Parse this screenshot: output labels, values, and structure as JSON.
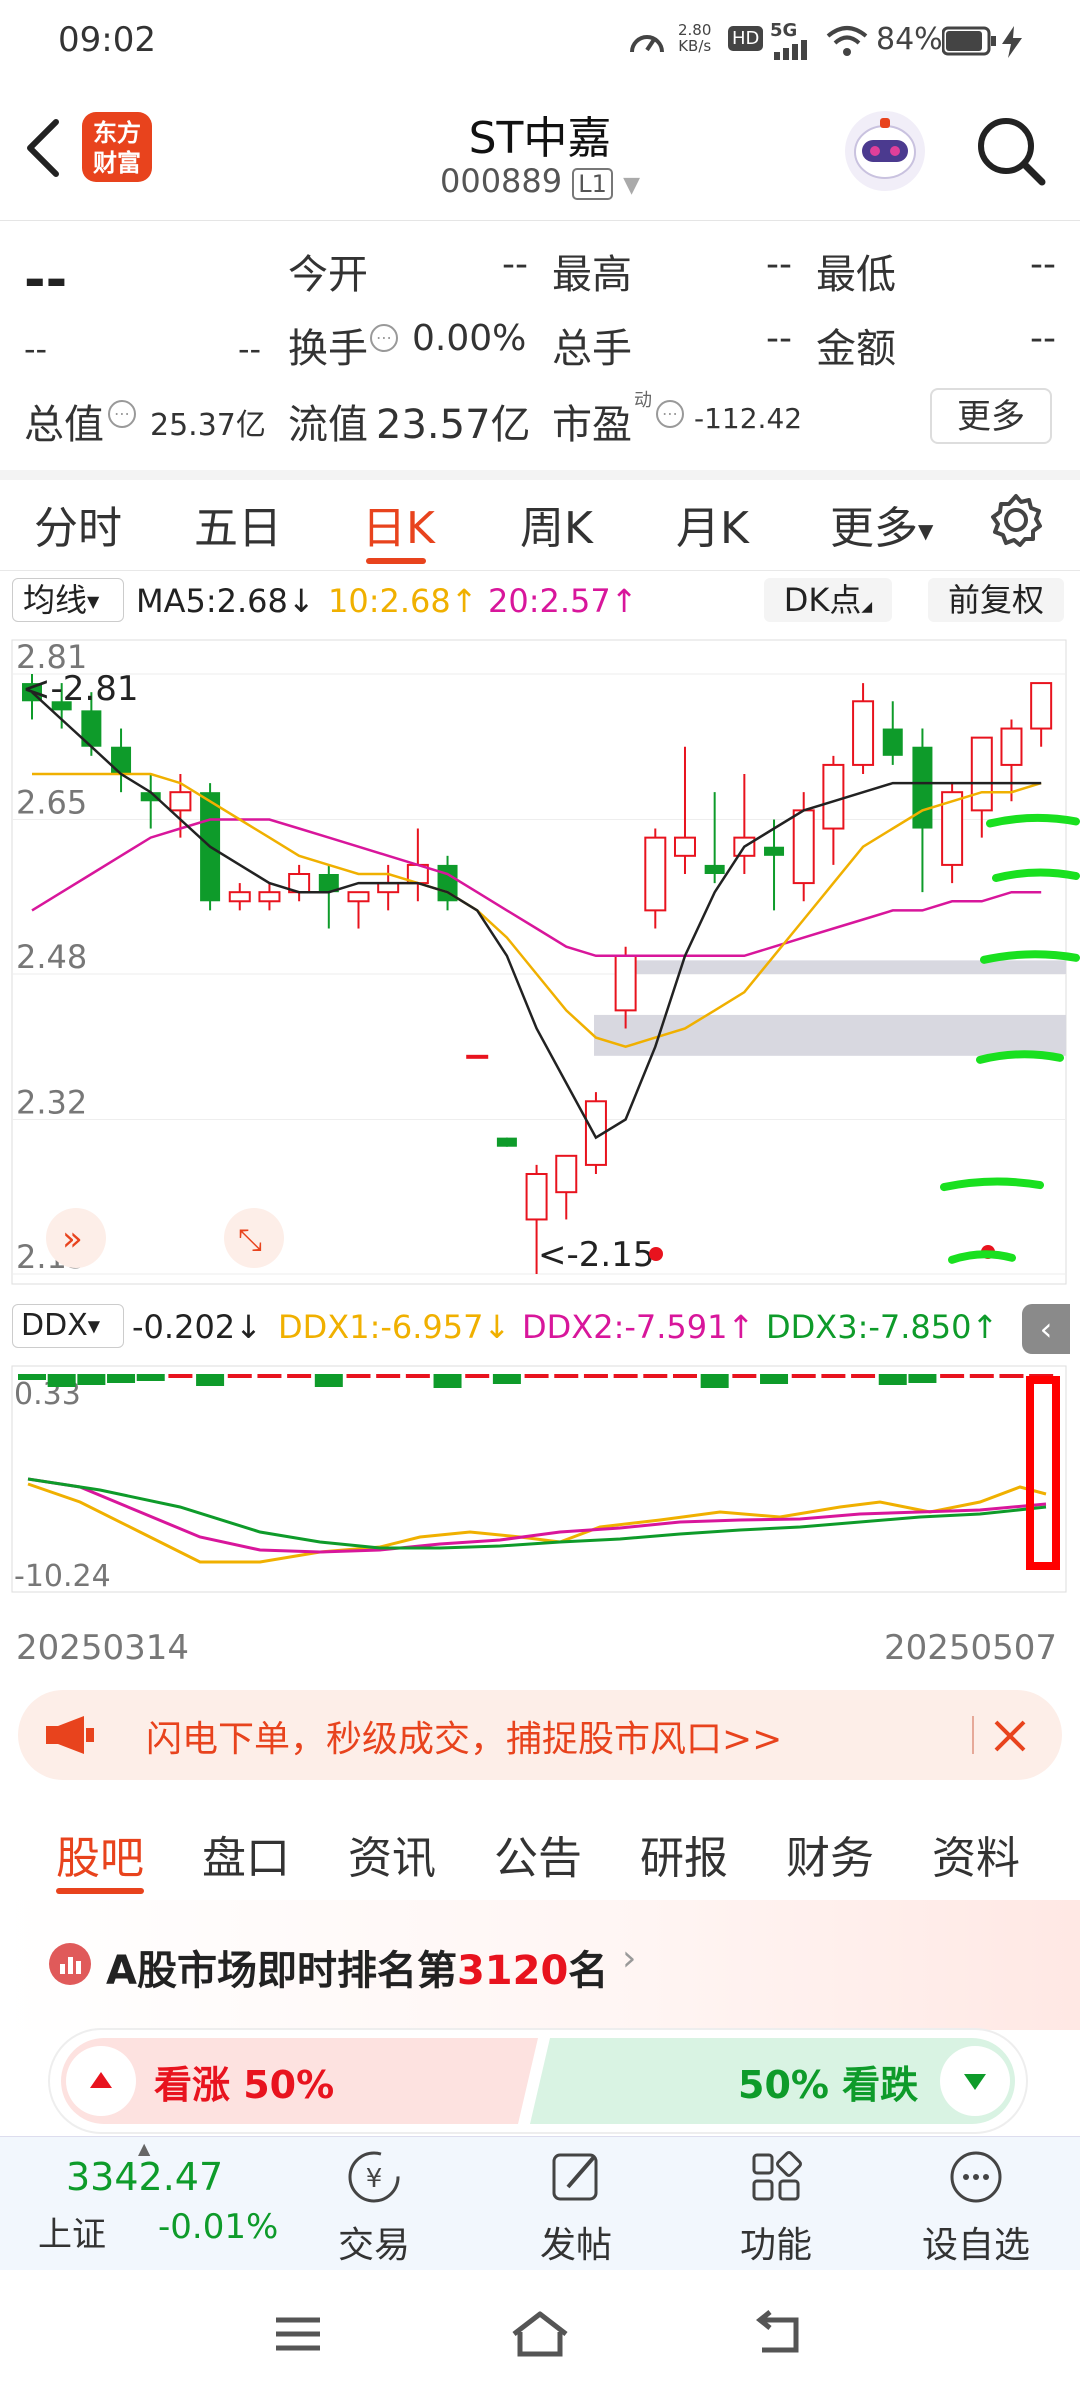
{
  "status": {
    "time": "09:02",
    "speed_value": "2.80",
    "speed_unit": "KB/s",
    "hd": "HD",
    "net": "5G",
    "battery": "84%"
  },
  "header": {
    "title": "ST中嘉",
    "code": "000889",
    "level": "L1",
    "logo_line1": "东方",
    "logo_line2": "财富"
  },
  "quote": {
    "price": "--",
    "change": "--",
    "change_pct": "--",
    "open_label": "今开",
    "open": "--",
    "high_label": "最高",
    "high": "--",
    "low_label": "最低",
    "low": "--",
    "turnover_label": "换手",
    "turnover": "0.00%",
    "volume_label": "总手",
    "volume": "--",
    "amount_label": "金额",
    "amount": "--",
    "mktcap_label": "总值",
    "mktcap": "25.37亿",
    "float_label": "流值",
    "float": "23.57亿",
    "pe_label": "市盈",
    "pe_sup": "动",
    "pe": "-112.42",
    "more_button": "更多"
  },
  "period_tabs": [
    "分时",
    "五日",
    "日K",
    "周K",
    "月K",
    "更多"
  ],
  "active_period": "日K",
  "ma_bar": {
    "selector": "均线",
    "ma5": "MA5:2.68",
    "ma10": "10:2.68",
    "ma20": "20:2.57",
    "dk": "DK点",
    "adjust": "前复权"
  },
  "ddx_bar": {
    "selector": "DDX",
    "ddx": "-0.202",
    "ddx1": "DDX1:-6.957",
    "ddx2": "DDX2:-7.591",
    "ddx3": "DDX3:-7.850"
  },
  "colors": {
    "up": "#e8131e",
    "down": "#0e9b2a",
    "ma5": "#222222",
    "ma10": "#f0b000",
    "ma20": "#d8169b",
    "accent": "#e8431d"
  },
  "chart_data": {
    "type": "candlestick",
    "y_ticks": [
      "2.81",
      "2.65",
      "2.48",
      "2.32",
      "2.15"
    ],
    "ylim": [
      2.15,
      2.81
    ],
    "max_marker": "<-2.81",
    "min_marker": "<-2.15",
    "start_date": "20250314",
    "end_date": "20250507",
    "ddx_ticks": [
      "0.33",
      "-10.24"
    ],
    "candles": [
      [
        2.8,
        2.81,
        2.76,
        2.78
      ],
      [
        2.78,
        2.8,
        2.75,
        2.77
      ],
      [
        2.77,
        2.79,
        2.72,
        2.73
      ],
      [
        2.73,
        2.75,
        2.68,
        2.7
      ],
      [
        2.68,
        2.7,
        2.64,
        2.67
      ],
      [
        2.66,
        2.7,
        2.63,
        2.68
      ],
      [
        2.68,
        2.69,
        2.55,
        2.56
      ],
      [
        2.56,
        2.58,
        2.55,
        2.57
      ],
      [
        2.56,
        2.58,
        2.55,
        2.57
      ],
      [
        2.57,
        2.6,
        2.56,
        2.59
      ],
      [
        2.59,
        2.6,
        2.53,
        2.57
      ],
      [
        2.56,
        2.57,
        2.53,
        2.57
      ],
      [
        2.57,
        2.6,
        2.55,
        2.58
      ],
      [
        2.58,
        2.64,
        2.56,
        2.6
      ],
      [
        2.6,
        2.61,
        2.55,
        2.56
      ],
      [
        2.39,
        2.39,
        2.39,
        2.39
      ],
      [
        2.3,
        2.3,
        2.29,
        2.29
      ],
      [
        2.21,
        2.27,
        2.15,
        2.26
      ],
      [
        2.24,
        2.28,
        2.21,
        2.28
      ],
      [
        2.27,
        2.35,
        2.26,
        2.34
      ],
      [
        2.44,
        2.51,
        2.42,
        2.5
      ],
      [
        2.55,
        2.64,
        2.53,
        2.63
      ],
      [
        2.61,
        2.73,
        2.59,
        2.63
      ],
      [
        2.6,
        2.68,
        2.58,
        2.59
      ],
      [
        2.61,
        2.7,
        2.59,
        2.63
      ],
      [
        2.62,
        2.65,
        2.55,
        2.61
      ],
      [
        2.58,
        2.68,
        2.56,
        2.66
      ],
      [
        2.64,
        2.72,
        2.6,
        2.71
      ],
      [
        2.71,
        2.8,
        2.7,
        2.78
      ],
      [
        2.75,
        2.78,
        2.71,
        2.72
      ],
      [
        2.73,
        2.75,
        2.57,
        2.64
      ],
      [
        2.6,
        2.69,
        2.58,
        2.68
      ],
      [
        2.66,
        2.74,
        2.63,
        2.74
      ],
      [
        2.71,
        2.76,
        2.67,
        2.75
      ],
      [
        2.75,
        2.8,
        2.73,
        2.8
      ]
    ],
    "ma5": [
      2.79,
      2.76,
      2.73,
      2.7,
      2.68,
      2.65,
      2.62,
      2.6,
      2.58,
      2.57,
      2.57,
      2.58,
      2.58,
      2.58,
      2.57,
      2.55,
      2.5,
      2.42,
      2.36,
      2.3,
      2.32,
      2.4,
      2.5,
      2.57,
      2.62,
      2.64,
      2.66,
      2.67,
      2.68,
      2.69,
      2.69,
      2.69,
      2.69,
      2.69,
      2.69
    ],
    "ma10": [
      2.7,
      2.7,
      2.7,
      2.7,
      2.7,
      2.69,
      2.67,
      2.65,
      2.63,
      2.61,
      2.6,
      2.59,
      2.59,
      2.58,
      2.57,
      2.55,
      2.52,
      2.48,
      2.44,
      2.41,
      2.4,
      2.41,
      2.42,
      2.44,
      2.46,
      2.5,
      2.54,
      2.58,
      2.62,
      2.64,
      2.66,
      2.67,
      2.68,
      2.68,
      2.69
    ],
    "ma20": [
      2.55,
      2.57,
      2.59,
      2.61,
      2.63,
      2.64,
      2.65,
      2.65,
      2.65,
      2.64,
      2.63,
      2.62,
      2.61,
      2.6,
      2.59,
      2.57,
      2.55,
      2.53,
      2.51,
      2.5,
      2.5,
      2.5,
      2.5,
      2.5,
      2.5,
      2.51,
      2.52,
      2.53,
      2.54,
      2.55,
      2.55,
      2.56,
      2.56,
      2.57,
      2.57
    ]
  },
  "ad": {
    "text": "闪电下单，秒级成交，捕捉股市风口>>"
  },
  "info_tabs": [
    "股吧",
    "盘口",
    "资讯",
    "公告",
    "研报",
    "财务",
    "资料"
  ],
  "active_info_tab": "股吧",
  "rank": {
    "prefix": "A股市场即时排名第",
    "number": "3120",
    "suffix": "名"
  },
  "vote": {
    "up": "看涨 50%",
    "down": "50% 看跌"
  },
  "bottom_nav": {
    "index_value": "3342.47",
    "index_name": "上证",
    "index_change": "-0.01%",
    "trade": "交易",
    "post": "发帖",
    "func": "功能",
    "watch": "设自选"
  }
}
